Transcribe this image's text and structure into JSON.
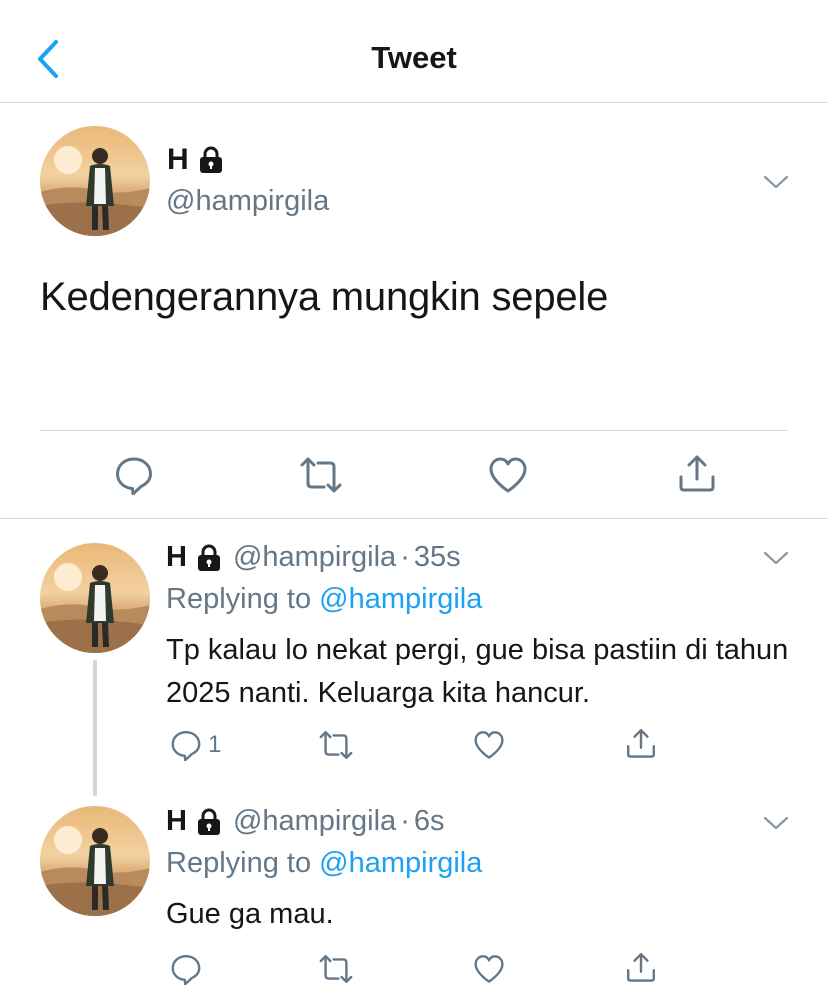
{
  "header": {
    "title": "Tweet"
  },
  "main_tweet": {
    "name": "H",
    "handle": "@hampirgila",
    "text": "Kedengerannya mungkin sepele"
  },
  "replies": [
    {
      "name": "H",
      "handle": "@hampirgila",
      "dot": "·",
      "time": "35s",
      "replying_label": "Replying to",
      "replying_to": "@hampirgila",
      "text": "Tp kalau lo nekat pergi, gue bisa pastiin di tahun 2025 nanti. Keluarga kita hancur.",
      "reply_count": "1"
    },
    {
      "name": "H",
      "handle": "@hampirgila",
      "dot": "·",
      "time": "6s",
      "replying_label": "Replying to",
      "replying_to": "@hampirgila",
      "text": "Gue ga mau.",
      "reply_count": ""
    }
  ],
  "colors": {
    "accent": "#1da1f2",
    "text_primary": "#14171a",
    "text_secondary": "#657786",
    "divider": "#d9dde0"
  },
  "icons": [
    "back-arrow-icon",
    "lock-icon",
    "chevron-down-icon",
    "reply-icon",
    "retweet-icon",
    "like-icon",
    "share-icon"
  ]
}
